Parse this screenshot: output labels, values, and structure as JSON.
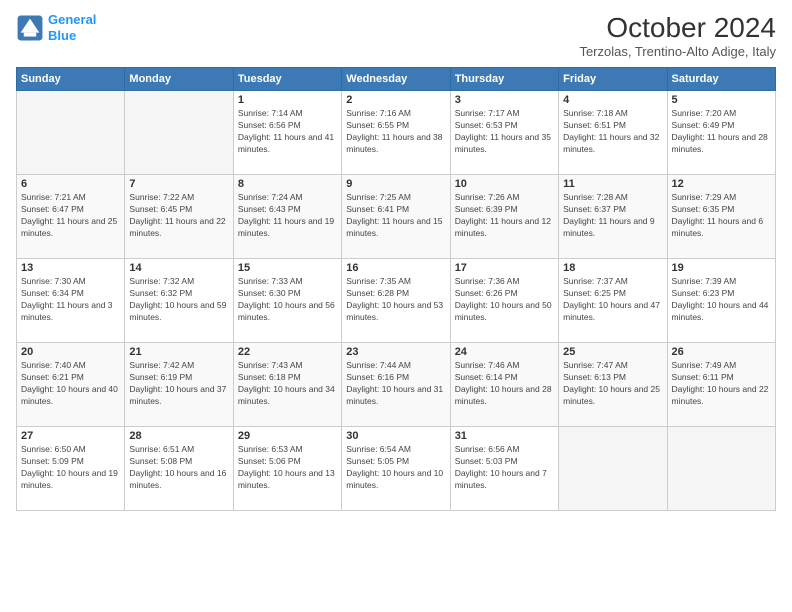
{
  "header": {
    "logo_line1": "General",
    "logo_line2": "Blue",
    "month": "October 2024",
    "location": "Terzolas, Trentino-Alto Adige, Italy"
  },
  "days_of_week": [
    "Sunday",
    "Monday",
    "Tuesday",
    "Wednesday",
    "Thursday",
    "Friday",
    "Saturday"
  ],
  "weeks": [
    [
      {
        "day": "",
        "sunrise": "",
        "sunset": "",
        "daylight": ""
      },
      {
        "day": "",
        "sunrise": "",
        "sunset": "",
        "daylight": ""
      },
      {
        "day": "1",
        "sunrise": "Sunrise: 7:14 AM",
        "sunset": "Sunset: 6:56 PM",
        "daylight": "Daylight: 11 hours and 41 minutes."
      },
      {
        "day": "2",
        "sunrise": "Sunrise: 7:16 AM",
        "sunset": "Sunset: 6:55 PM",
        "daylight": "Daylight: 11 hours and 38 minutes."
      },
      {
        "day": "3",
        "sunrise": "Sunrise: 7:17 AM",
        "sunset": "Sunset: 6:53 PM",
        "daylight": "Daylight: 11 hours and 35 minutes."
      },
      {
        "day": "4",
        "sunrise": "Sunrise: 7:18 AM",
        "sunset": "Sunset: 6:51 PM",
        "daylight": "Daylight: 11 hours and 32 minutes."
      },
      {
        "day": "5",
        "sunrise": "Sunrise: 7:20 AM",
        "sunset": "Sunset: 6:49 PM",
        "daylight": "Daylight: 11 hours and 28 minutes."
      }
    ],
    [
      {
        "day": "6",
        "sunrise": "Sunrise: 7:21 AM",
        "sunset": "Sunset: 6:47 PM",
        "daylight": "Daylight: 11 hours and 25 minutes."
      },
      {
        "day": "7",
        "sunrise": "Sunrise: 7:22 AM",
        "sunset": "Sunset: 6:45 PM",
        "daylight": "Daylight: 11 hours and 22 minutes."
      },
      {
        "day": "8",
        "sunrise": "Sunrise: 7:24 AM",
        "sunset": "Sunset: 6:43 PM",
        "daylight": "Daylight: 11 hours and 19 minutes."
      },
      {
        "day": "9",
        "sunrise": "Sunrise: 7:25 AM",
        "sunset": "Sunset: 6:41 PM",
        "daylight": "Daylight: 11 hours and 15 minutes."
      },
      {
        "day": "10",
        "sunrise": "Sunrise: 7:26 AM",
        "sunset": "Sunset: 6:39 PM",
        "daylight": "Daylight: 11 hours and 12 minutes."
      },
      {
        "day": "11",
        "sunrise": "Sunrise: 7:28 AM",
        "sunset": "Sunset: 6:37 PM",
        "daylight": "Daylight: 11 hours and 9 minutes."
      },
      {
        "day": "12",
        "sunrise": "Sunrise: 7:29 AM",
        "sunset": "Sunset: 6:35 PM",
        "daylight": "Daylight: 11 hours and 6 minutes."
      }
    ],
    [
      {
        "day": "13",
        "sunrise": "Sunrise: 7:30 AM",
        "sunset": "Sunset: 6:34 PM",
        "daylight": "Daylight: 11 hours and 3 minutes."
      },
      {
        "day": "14",
        "sunrise": "Sunrise: 7:32 AM",
        "sunset": "Sunset: 6:32 PM",
        "daylight": "Daylight: 10 hours and 59 minutes."
      },
      {
        "day": "15",
        "sunrise": "Sunrise: 7:33 AM",
        "sunset": "Sunset: 6:30 PM",
        "daylight": "Daylight: 10 hours and 56 minutes."
      },
      {
        "day": "16",
        "sunrise": "Sunrise: 7:35 AM",
        "sunset": "Sunset: 6:28 PM",
        "daylight": "Daylight: 10 hours and 53 minutes."
      },
      {
        "day": "17",
        "sunrise": "Sunrise: 7:36 AM",
        "sunset": "Sunset: 6:26 PM",
        "daylight": "Daylight: 10 hours and 50 minutes."
      },
      {
        "day": "18",
        "sunrise": "Sunrise: 7:37 AM",
        "sunset": "Sunset: 6:25 PM",
        "daylight": "Daylight: 10 hours and 47 minutes."
      },
      {
        "day": "19",
        "sunrise": "Sunrise: 7:39 AM",
        "sunset": "Sunset: 6:23 PM",
        "daylight": "Daylight: 10 hours and 44 minutes."
      }
    ],
    [
      {
        "day": "20",
        "sunrise": "Sunrise: 7:40 AM",
        "sunset": "Sunset: 6:21 PM",
        "daylight": "Daylight: 10 hours and 40 minutes."
      },
      {
        "day": "21",
        "sunrise": "Sunrise: 7:42 AM",
        "sunset": "Sunset: 6:19 PM",
        "daylight": "Daylight: 10 hours and 37 minutes."
      },
      {
        "day": "22",
        "sunrise": "Sunrise: 7:43 AM",
        "sunset": "Sunset: 6:18 PM",
        "daylight": "Daylight: 10 hours and 34 minutes."
      },
      {
        "day": "23",
        "sunrise": "Sunrise: 7:44 AM",
        "sunset": "Sunset: 6:16 PM",
        "daylight": "Daylight: 10 hours and 31 minutes."
      },
      {
        "day": "24",
        "sunrise": "Sunrise: 7:46 AM",
        "sunset": "Sunset: 6:14 PM",
        "daylight": "Daylight: 10 hours and 28 minutes."
      },
      {
        "day": "25",
        "sunrise": "Sunrise: 7:47 AM",
        "sunset": "Sunset: 6:13 PM",
        "daylight": "Daylight: 10 hours and 25 minutes."
      },
      {
        "day": "26",
        "sunrise": "Sunrise: 7:49 AM",
        "sunset": "Sunset: 6:11 PM",
        "daylight": "Daylight: 10 hours and 22 minutes."
      }
    ],
    [
      {
        "day": "27",
        "sunrise": "Sunrise: 6:50 AM",
        "sunset": "Sunset: 5:09 PM",
        "daylight": "Daylight: 10 hours and 19 minutes."
      },
      {
        "day": "28",
        "sunrise": "Sunrise: 6:51 AM",
        "sunset": "Sunset: 5:08 PM",
        "daylight": "Daylight: 10 hours and 16 minutes."
      },
      {
        "day": "29",
        "sunrise": "Sunrise: 6:53 AM",
        "sunset": "Sunset: 5:06 PM",
        "daylight": "Daylight: 10 hours and 13 minutes."
      },
      {
        "day": "30",
        "sunrise": "Sunrise: 6:54 AM",
        "sunset": "Sunset: 5:05 PM",
        "daylight": "Daylight: 10 hours and 10 minutes."
      },
      {
        "day": "31",
        "sunrise": "Sunrise: 6:56 AM",
        "sunset": "Sunset: 5:03 PM",
        "daylight": "Daylight: 10 hours and 7 minutes."
      },
      {
        "day": "",
        "sunrise": "",
        "sunset": "",
        "daylight": ""
      },
      {
        "day": "",
        "sunrise": "",
        "sunset": "",
        "daylight": ""
      }
    ]
  ]
}
